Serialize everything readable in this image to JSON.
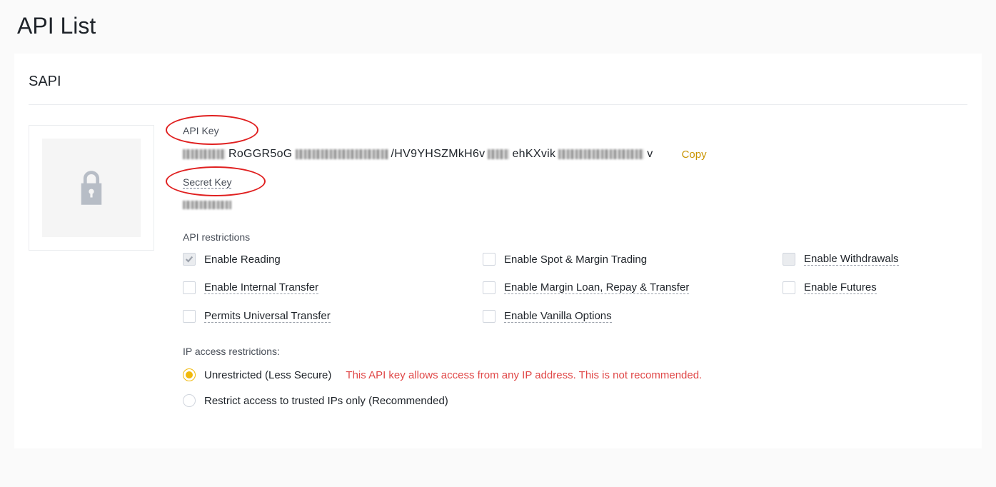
{
  "page_title": "API List",
  "card_title": "SAPI",
  "api_key": {
    "label": "API Key",
    "seg1": "RoGGR5oG",
    "seg2": "/HV9YHSZMkH6v",
    "seg3": "ehKXvik",
    "seg4": "v",
    "copy_label": "Copy"
  },
  "secret_key": {
    "label": "Secret Key"
  },
  "restrictions": {
    "label": "API restrictions",
    "items": [
      {
        "label": "Enable Reading",
        "checked": true,
        "underlined": false
      },
      {
        "label": "Enable Spot & Margin Trading",
        "checked": false,
        "underlined": false
      },
      {
        "label": "Enable Withdrawals",
        "checked": false,
        "underlined": true,
        "disabled_bg": true
      },
      {
        "label": "Enable Internal Transfer",
        "checked": false,
        "underlined": true
      },
      {
        "label": "Enable Margin Loan, Repay & Transfer",
        "checked": false,
        "underlined": true
      },
      {
        "label": "Enable Futures",
        "checked": false,
        "underlined": true
      },
      {
        "label": "Permits Universal Transfer",
        "checked": false,
        "underlined": true
      },
      {
        "label": "Enable Vanilla Options",
        "checked": false,
        "underlined": true
      }
    ]
  },
  "ip": {
    "title": "IP access restrictions:",
    "options": [
      {
        "label": "Unrestricted (Less Secure)",
        "selected": true,
        "warning": "This API key allows access from any IP address. This is not recommended."
      },
      {
        "label": "Restrict access to trusted IPs only (Recommended)",
        "selected": false
      }
    ]
  }
}
